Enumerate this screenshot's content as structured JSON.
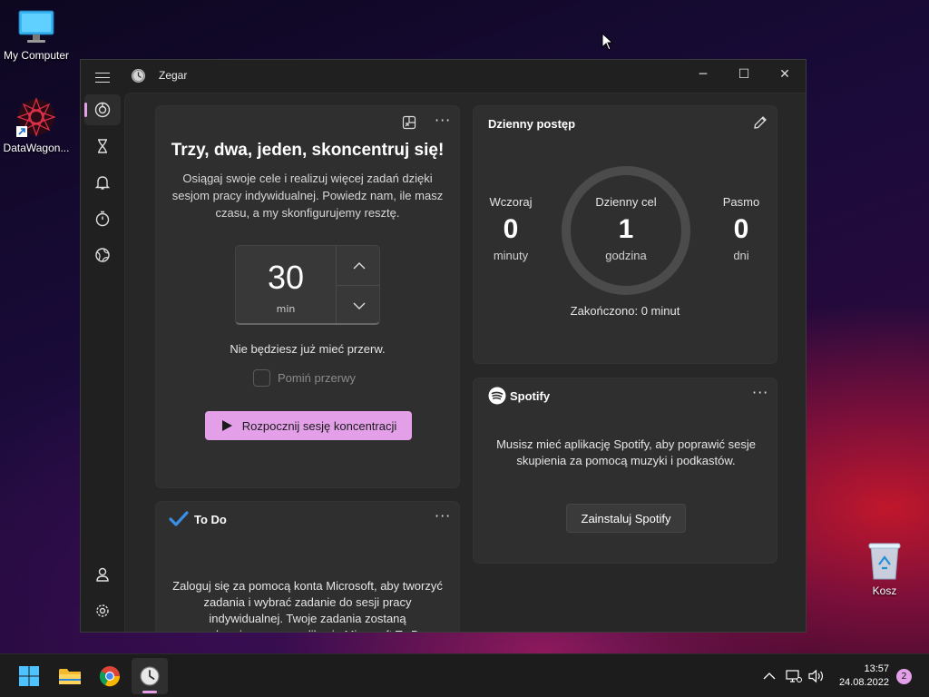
{
  "desktop": {
    "icons": [
      {
        "label": "My Computer"
      },
      {
        "label": "DataWagon..."
      },
      {
        "label": "Kosz"
      }
    ]
  },
  "window": {
    "title": "Zegar",
    "controls": {
      "minimize": "─",
      "maximize": "☐",
      "close": "✕"
    }
  },
  "nav": {
    "items": [
      "focus-sessions",
      "timer",
      "alarm",
      "stopwatch",
      "world-clock"
    ],
    "active": "focus-sessions",
    "bottom": [
      "account",
      "settings"
    ]
  },
  "focus": {
    "title": "Trzy, dwa, jeden, skoncentruj się!",
    "description": "Osiągaj swoje cele i realizuj więcej zadań dzięki sesjom pracy indywidualnej. Powiedz nam, ile masz czasu, a my skonfigurujemy resztę.",
    "minutes": "30",
    "unit": "min",
    "break_text": "Nie będziesz już mieć przerw.",
    "skip_label": "Pomiń przerwy",
    "skip_checked": false,
    "start_label": "Rozpocznij sesję koncentracji"
  },
  "progress": {
    "title": "Dzienny postęp",
    "yesterday": {
      "label": "Wczoraj",
      "value": "0",
      "unit": "minuty"
    },
    "goal": {
      "label": "Dzienny cel",
      "value": "1",
      "unit": "godzina"
    },
    "streak": {
      "label": "Pasmo",
      "value": "0",
      "unit": "dni"
    },
    "completed": "Zakończono: 0 minut"
  },
  "spotify": {
    "title": "Spotify",
    "description": "Musisz mieć aplikację Spotify, aby poprawić sesje skupienia za pomocą muzyki i podkastów.",
    "install_label": "Zainstaluj Spotify"
  },
  "todo": {
    "title": "To Do",
    "description": "Zaloguj się za pomocą konta Microsoft, aby tworzyć zadania i wybrać zadanie do sesji pracy indywidualnej. Twoje zadania zostaną zsynchronizowane z aplikacją Microsoft To Do."
  },
  "taskbar": {
    "time": "13:57",
    "date": "24.08.2022",
    "notifications": "2",
    "accent": "#e3a0e8"
  }
}
